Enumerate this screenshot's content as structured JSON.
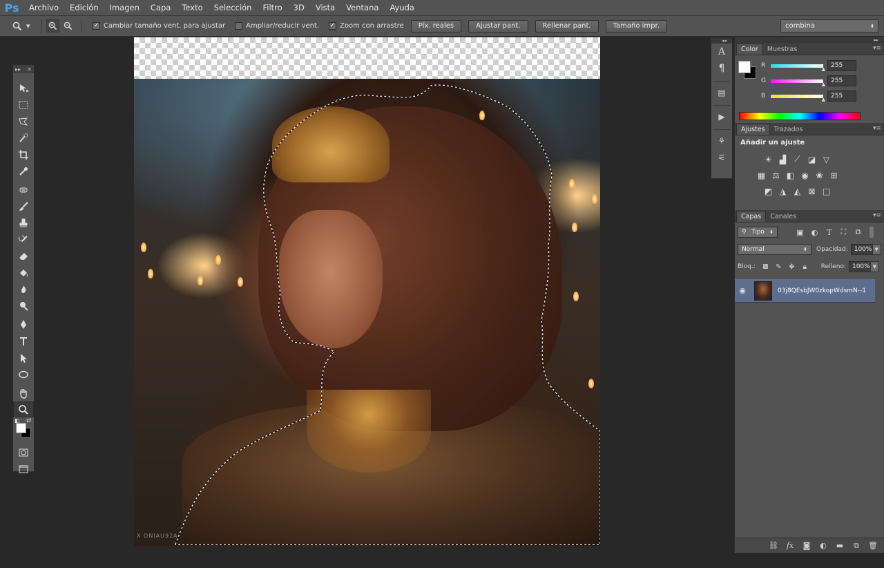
{
  "app": {
    "logo": "Ps"
  },
  "menu": [
    "Archivo",
    "Edición",
    "Imagen",
    "Capa",
    "Texto",
    "Selección",
    "Filtro",
    "3D",
    "Vista",
    "Ventana",
    "Ayuda"
  ],
  "options": {
    "resize_windows_label": "Cambiar tamaño vent. para ajustar",
    "resize_windows_checked": true,
    "zoom_all_label": "Ampliar/reducir vent.",
    "zoom_all_checked": false,
    "scrubby_label": "Zoom con arrastre",
    "scrubby_checked": true,
    "actual_pixels": "Píx. reales",
    "fit_screen": "Ajustar pant.",
    "fill_screen": "Rellenar pant.",
    "print_size": "Tamaño impr.",
    "workspace": "combina"
  },
  "canvas": {
    "watermark": "X ONIAU92A"
  },
  "color_panel": {
    "tab_color": "Color",
    "tab_swatches": "Muestras",
    "r_label": "R",
    "r_value": "255",
    "g_label": "G",
    "g_value": "255",
    "b_label": "B",
    "b_value": "255",
    "accent_r": "#1ee3e8",
    "accent_g": "#e81ee8",
    "accent_b": "#e8e81e"
  },
  "adjustments_panel": {
    "tab_adjustments": "Ajustes",
    "tab_paths": "Trazados",
    "title": "Añadir un ajuste"
  },
  "layers_panel": {
    "tab_layers": "Capas",
    "tab_channels": "Canales",
    "filter_kind": "Tipo",
    "blend_mode": "Normal",
    "opacity_label": "Opacidad:",
    "opacity_value": "100%",
    "lock_label": "Bloq.:",
    "fill_label": "Relleno:",
    "fill_value": "100%",
    "layer_name": "03j8QEsbJW0zkopWdsmN--1..."
  }
}
